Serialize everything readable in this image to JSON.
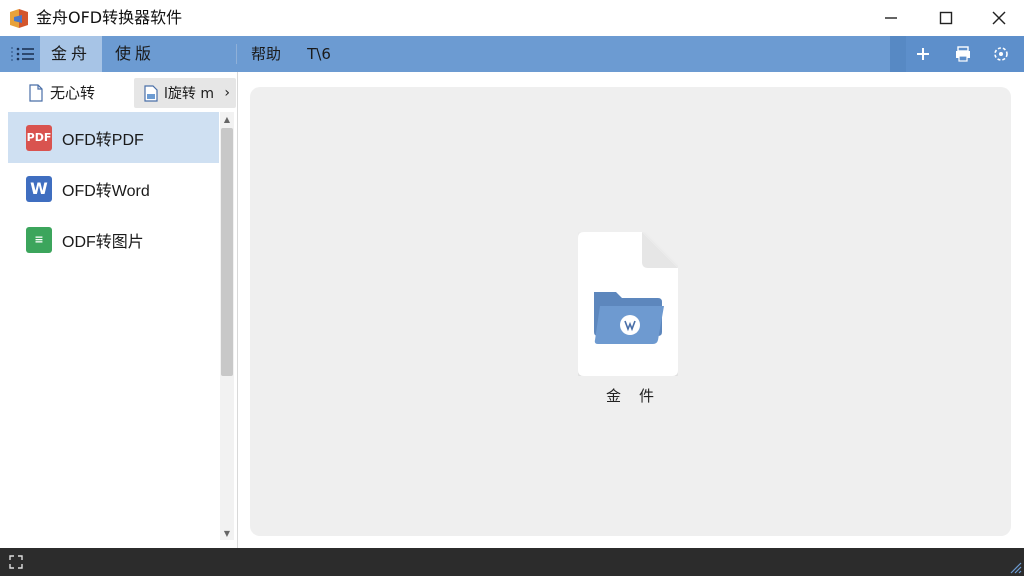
{
  "window": {
    "title": "金舟OFD转换器软件"
  },
  "menubar": {
    "tabs": [
      {
        "label": "金舟",
        "active": true
      },
      {
        "label": "使版",
        "active": false
      },
      {
        "label": "帮助",
        "active": false
      },
      {
        "label": "T\\6",
        "active": false
      }
    ],
    "right_icons": [
      "plus-icon",
      "printer-icon",
      "settings-icon"
    ]
  },
  "breadcrumb": {
    "root_label": "无心转",
    "child_label": "l旋转 m",
    "chevron": "›"
  },
  "functions": [
    {
      "label": "OFD转PDF",
      "icon_text": "PDF",
      "icon": "pdf-icon",
      "selected": true
    },
    {
      "label": "OFD转Word",
      "icon_text": "W",
      "icon": "word-icon",
      "selected": false
    },
    {
      "label": "ODF转图片",
      "icon_text": "≡",
      "icon": "image-icon",
      "selected": false
    }
  ],
  "scrollbar": {
    "up_arrow": "▲",
    "down_arrow": "▼"
  },
  "main": {
    "drop_label": "金件"
  },
  "colors": {
    "menubar": "#6c9bd2",
    "active_tab": "#a7c4e6",
    "selected_row": "#cfe0f2",
    "drop_area": "#efefef",
    "statusbar": "#2c2c2c"
  }
}
